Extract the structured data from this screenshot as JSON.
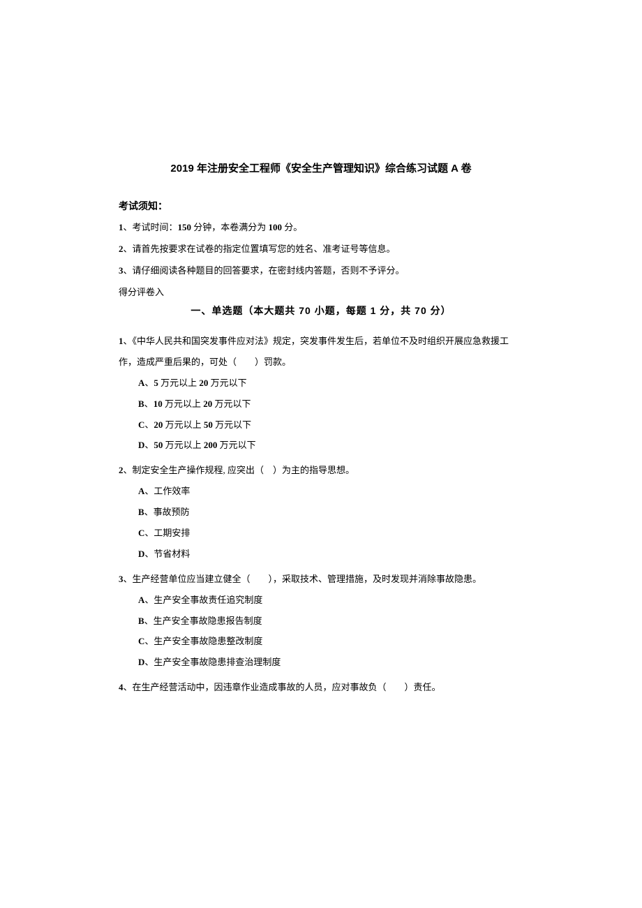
{
  "title": "2019 年注册安全工程师《安全生产管理知识》综合练习试题 A 卷",
  "notice_header": "考试须知：",
  "notices": [
    {
      "num": "1",
      "text": "、考试时间：",
      "boldPart": "150",
      "rest": " 分钟，本卷满分为 ",
      "boldPart2": "100",
      "rest2": " 分。"
    },
    {
      "num": "2",
      "text": "、请首先按要求在试卷的指定位置填写您的姓名、准考证号等信息。"
    },
    {
      "num": "3",
      "text": "、请仔细阅读各种题目的回答要求，在密封线内答题，否则不予评分。"
    }
  ],
  "score_line": "得分评卷入",
  "section_title": "一、单选题（本大题共 70 小题，每题 1 分，共 70 分）",
  "questions": [
    {
      "num": "1",
      "text": "、《中华人民共和国突发事件应对法》规定，突发事件发生后，若单位不及时组织开展应急救援工作，造成严重后果的，可处（　　）罚款。",
      "options": [
        {
          "letter": "A",
          "text": "、",
          "bold": "5",
          "rest": " 万元以上 ",
          "bold2": "20",
          "rest2": " 万元以下"
        },
        {
          "letter": "B",
          "text": "、",
          "bold": "10",
          "rest": " 万元以上 ",
          "bold2": "20",
          "rest2": " 万元以下"
        },
        {
          "letter": "C",
          "text": "、",
          "bold": "20",
          "rest": " 万元以上 ",
          "bold2": "50",
          "rest2": " 万元以下"
        },
        {
          "letter": "D",
          "text": "、",
          "bold": "50",
          "rest": " 万元以上 ",
          "bold2": "200",
          "rest2": " 万元以下"
        }
      ]
    },
    {
      "num": "2",
      "text": "、制定安全生产操作规程, 应突出（　）为主的指导思想。",
      "options": [
        {
          "letter": "A",
          "text": "、工作效率"
        },
        {
          "letter": "B",
          "text": "、事故预防"
        },
        {
          "letter": "C",
          "text": "、工期安排"
        },
        {
          "letter": "D",
          "text": "、节省材料"
        }
      ]
    },
    {
      "num": "3",
      "text": "、生产经营单位应当建立健全（　　），采取技术、管理措施，及时发现并消除事故隐患。",
      "options": [
        {
          "letter": "A",
          "text": "、生产安全事故责任追究制度"
        },
        {
          "letter": "B",
          "text": "、生产安全事故隐患报告制度"
        },
        {
          "letter": "C",
          "text": "、生产安全事故隐患整改制度"
        },
        {
          "letter": "D",
          "text": "、生产安全事故隐患排查治理制度"
        }
      ]
    },
    {
      "num": "4",
      "text": "、在生产经营活动中，因违章作业造成事故的人员，应对事故负（　　）责任。",
      "options": []
    }
  ]
}
